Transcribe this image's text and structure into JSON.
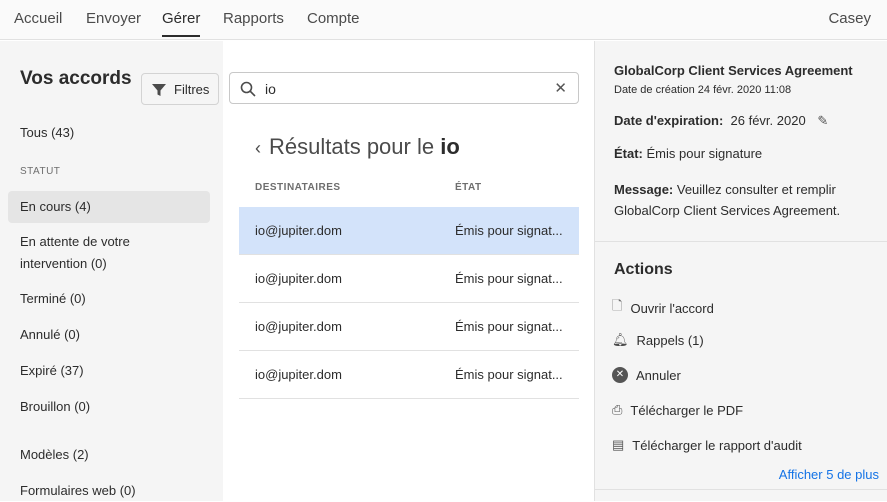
{
  "nav": {
    "items": [
      "Accueil",
      "Envoyer",
      "Gérer",
      "Rapports",
      "Compte"
    ],
    "active": "Gérer",
    "user": "Casey"
  },
  "sidebar": {
    "title": "Vos accords",
    "filter_label": "Filtres",
    "all": "Tous (43)",
    "status_header": "STATUT",
    "items": [
      "En cours (4)",
      "En attente de votre intervention (0)",
      "Terminé (0)",
      "Annulé (0)",
      "Expiré (37)",
      "Brouillon (0)"
    ],
    "templates": "Modèles (2)",
    "webforms": "Formulaires web (0)"
  },
  "search": {
    "value": "io"
  },
  "results": {
    "prefix": "Résultats pour le",
    "query": "io",
    "headers": [
      "DESTINATAIRES",
      "ÉTAT"
    ],
    "rows": [
      {
        "recipient": "io@jupiter.dom",
        "state": "Émis pour signat..."
      },
      {
        "recipient": "io@jupiter.dom",
        "state": "Émis pour signat..."
      },
      {
        "recipient": "io@jupiter.dom",
        "state": "Émis pour signat..."
      },
      {
        "recipient": "io@jupiter.dom",
        "state": "Émis pour signat..."
      }
    ]
  },
  "detail": {
    "name": "GlobalCorp Client Services Agreement",
    "created": "Date de création 24 févr. 2020 11:08",
    "exp_label": "Date d'expiration:",
    "exp_value": "26 févr. 2020",
    "state_label": "État:",
    "state_value": "Émis pour signature",
    "msg_label": "Message:",
    "msg_value": "Veuillez consulter et remplir GlobalCorp Client Services Agreement."
  },
  "actions": {
    "title": "Actions",
    "items": [
      "Ouvrir l'accord",
      "Rappels (1)",
      "Annuler",
      "Télécharger le PDF",
      "Télécharger le rapport d'audit"
    ],
    "more": "Afficher 5 de plus"
  },
  "colors": {
    "accent": "#1473e6",
    "selected_row": "#d3e3fa"
  }
}
